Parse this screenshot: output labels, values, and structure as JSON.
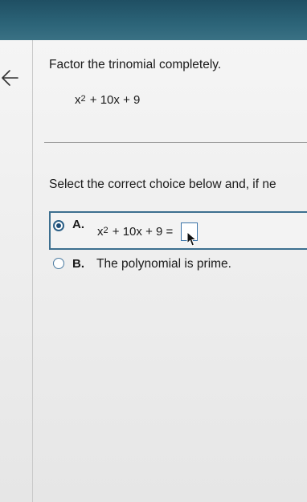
{
  "header": {
    "back_icon": "arrow-left-icon"
  },
  "question": {
    "prompt": "Factor the trinomial completely.",
    "expression": {
      "base": "x",
      "exponent": "2",
      "rest": " + 10x + 9"
    },
    "instruction": "Select the correct choice below and, if ne"
  },
  "choices": {
    "a": {
      "letter": "A.",
      "base": "x",
      "exponent": "2",
      "rest": " + 10x + 9 =",
      "selected": true,
      "answer_value": ""
    },
    "b": {
      "letter": "B.",
      "text": "The polynomial is prime.",
      "selected": false
    }
  },
  "colors": {
    "header_bar": "#2c6478",
    "selected_border": "#3d6f8f",
    "radio": "#2b5f86"
  }
}
